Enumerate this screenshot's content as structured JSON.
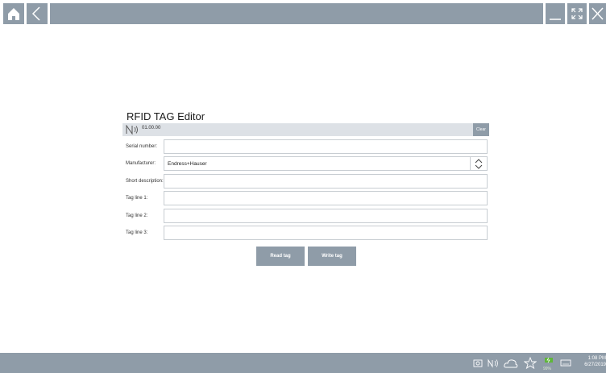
{
  "editor": {
    "title": "RFID TAG Editor",
    "version": "01.00.00",
    "clear_label": "Clear",
    "fields": [
      {
        "label": "Serial number:",
        "value": ""
      },
      {
        "label": "Manufacturer:",
        "value": "Endress+Hauser"
      },
      {
        "label": "Short description:",
        "value": ""
      },
      {
        "label": "Tag line 1:",
        "value": ""
      },
      {
        "label": "Tag line 2:",
        "value": ""
      },
      {
        "label": "Tag line 3:",
        "value": ""
      }
    ],
    "read_label": "Read tag",
    "write_label": "Write tag"
  },
  "taskbar": {
    "battery": "99%",
    "time": "1:08 PM",
    "date": "6/27/2019"
  },
  "colors": {
    "bar": "#8f9ca8",
    "status": "#dde1e6",
    "battery": "#5fb63a"
  },
  "icons": [
    "home-icon",
    "back-icon",
    "minimize-icon",
    "maximize-icon",
    "close-icon",
    "nfc-icon",
    "camera-icon",
    "cloud-icon",
    "star-icon",
    "battery-icon",
    "keyboard-icon"
  ]
}
